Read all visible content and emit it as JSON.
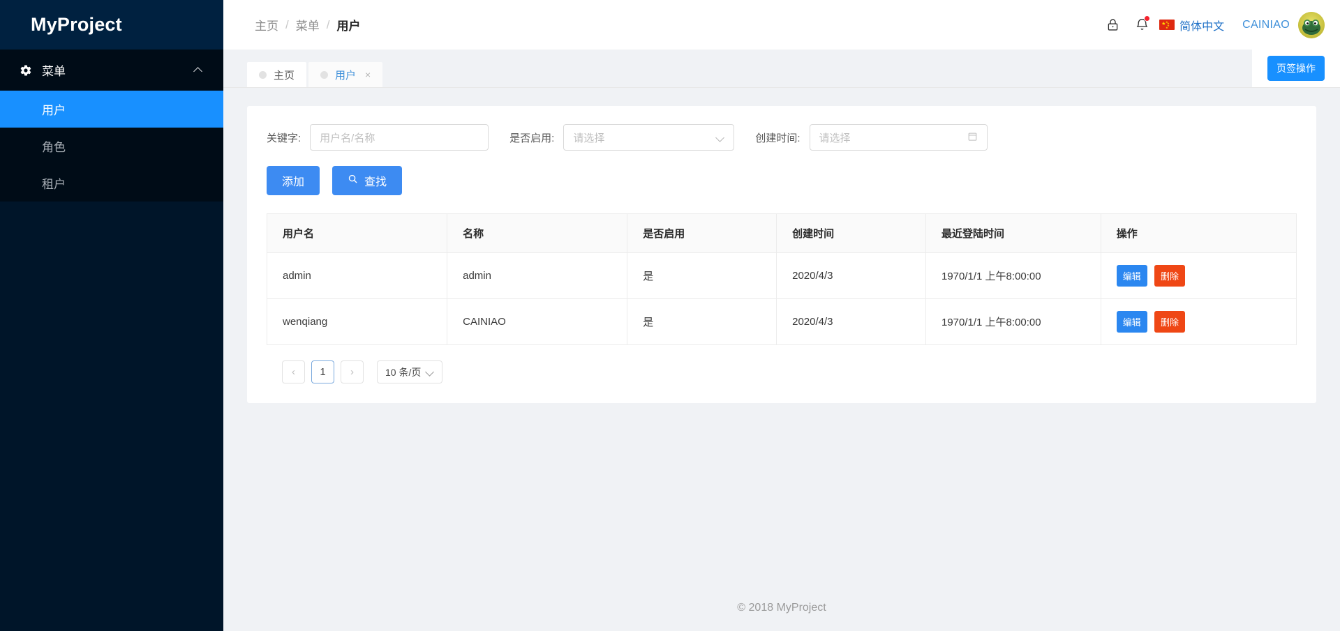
{
  "sidebar": {
    "logo": "MyProject",
    "group": {
      "label": "菜单",
      "icon": "gear-icon",
      "expanded_icon": "chevron-up-icon"
    },
    "items": [
      {
        "label": "用户",
        "active": true
      },
      {
        "label": "角色",
        "active": false
      },
      {
        "label": "租户",
        "active": false
      }
    ]
  },
  "header": {
    "breadcrumb": [
      "主页",
      "菜单",
      "用户"
    ],
    "separator": "/",
    "icons": [
      "lock-icon",
      "bell-icon"
    ],
    "notification_badge": true,
    "language": {
      "label": "简体中文",
      "flag": "china-flag-icon"
    },
    "username": "CAINIAO",
    "avatar": "user-avatar"
  },
  "tabs": {
    "items": [
      {
        "label": "主页",
        "active": false,
        "closable": false
      },
      {
        "label": "用户",
        "active": true,
        "closable": true,
        "close": "×"
      }
    ],
    "action_button": "页签操作"
  },
  "filters": {
    "keyword": {
      "label": "关键字:",
      "placeholder": "用户名/名称",
      "value": ""
    },
    "enabled": {
      "label": "是否启用:",
      "placeholder": "请选择",
      "value": ""
    },
    "created": {
      "label": "创建时间:",
      "placeholder": "请选择",
      "value": ""
    }
  },
  "actions": {
    "add": "添加",
    "search": "查找",
    "search_icon": "search-icon"
  },
  "table": {
    "columns": [
      "用户名",
      "名称",
      "是否启用",
      "创建时间",
      "最近登陆时间",
      "操作"
    ],
    "rows": [
      {
        "username": "admin",
        "name": "admin",
        "enabled": "是",
        "created": "2020/4/3",
        "last_login": "1970/1/1 上午8:00:00",
        "edit": "编辑",
        "delete": "删除"
      },
      {
        "username": "wenqiang",
        "name": "CAINIAO",
        "enabled": "是",
        "created": "2020/4/3",
        "last_login": "1970/1/1 上午8:00:00",
        "edit": "编辑",
        "delete": "删除"
      }
    ]
  },
  "pagination": {
    "prev": "‹",
    "next": "›",
    "current_page": "1",
    "page_size": "10 条/页"
  },
  "footer": {
    "copyright": "© 2018 MyProject"
  },
  "colors": {
    "sidebar_bg": "#001529",
    "sidebar_logo_bg": "#002140",
    "sidebar_submenu_bg": "#000c17",
    "accent": "#1890ff",
    "primary_button": "#3d8bf2",
    "danger_button": "#ef4715",
    "page_bg": "#f0f2f5",
    "badge": "#f5222d"
  }
}
